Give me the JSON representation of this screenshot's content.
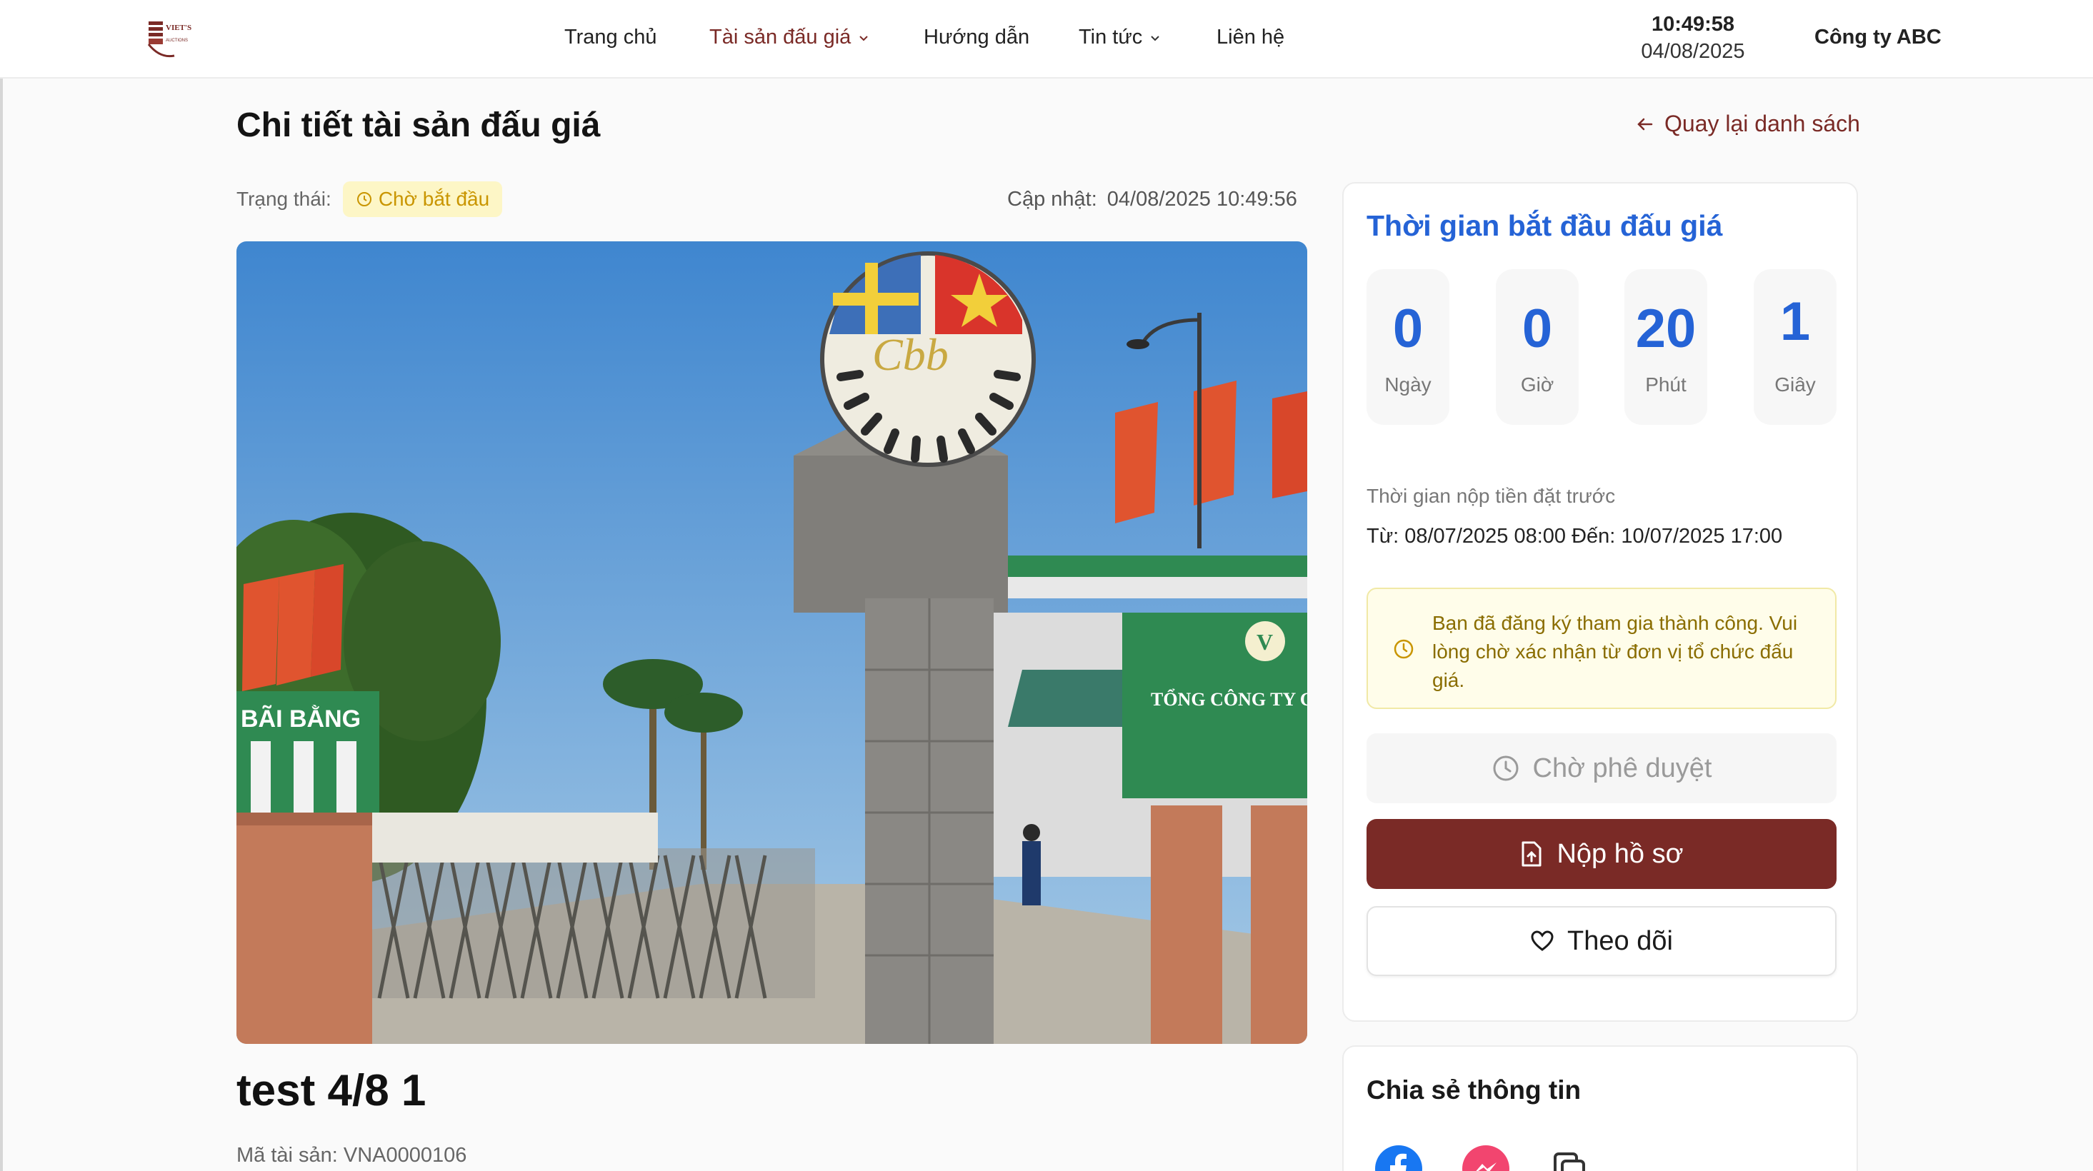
{
  "header": {
    "logo_text": "VIET'S AUCTIONS",
    "nav": [
      {
        "label": "Trang chủ",
        "active": false,
        "has_dropdown": false
      },
      {
        "label": "Tài sản đấu giá",
        "active": true,
        "has_dropdown": true
      },
      {
        "label": "Hướng dẫn",
        "active": false,
        "has_dropdown": false
      },
      {
        "label": "Tin tức",
        "active": false,
        "has_dropdown": true
      },
      {
        "label": "Liên hệ",
        "active": false,
        "has_dropdown": false
      }
    ],
    "clock_time": "10:49:58",
    "clock_date": "04/08/2025",
    "company": "Công ty ABC"
  },
  "page": {
    "title": "Chi tiết tài sản đấu giá",
    "back_label": "Quay lại danh sách",
    "status_label": "Trạng thái:",
    "status_value": "Chờ bắt đầu",
    "updated_label": "Cập nhật:",
    "updated_value": "04/08/2025 10:49:56"
  },
  "asset": {
    "name": "test 4/8 1",
    "code": "Mã tài sản: VNA0000106",
    "image_sign_text": "TỔNG CÔNG TY GIẤY",
    "image_gate_text": "BÃI BẰNG"
  },
  "countdown": {
    "title": "Thời gian bắt đầu đấu giá",
    "units": [
      {
        "value": "0",
        "label": "Ngày"
      },
      {
        "value": "0",
        "label": "Giờ"
      },
      {
        "value": "20",
        "label": "Phút"
      },
      {
        "value": "1",
        "label": "Giây"
      }
    ]
  },
  "deposit": {
    "label": "Thời gian nộp tiền đặt trước",
    "range": "Từ: 08/07/2025 08:00 Đến: 10/07/2025 17:00"
  },
  "notice": "Bạn đã đăng ký tham gia thành công. Vui lòng chờ xác nhận từ đơn vị tổ chức đấu giá.",
  "buttons": {
    "waiting": "Chờ phê duyệt",
    "submit": "Nộp hồ sơ",
    "follow": "Theo dõi"
  },
  "share": {
    "title": "Chia sẻ thông tin",
    "icons": [
      "facebook-icon",
      "messenger-icon",
      "copy-icon"
    ]
  },
  "colors": {
    "brand": "#7a2a26",
    "accent": "#2563d6",
    "badge_bg": "#fdf6c6",
    "badge_text": "#c99500"
  }
}
